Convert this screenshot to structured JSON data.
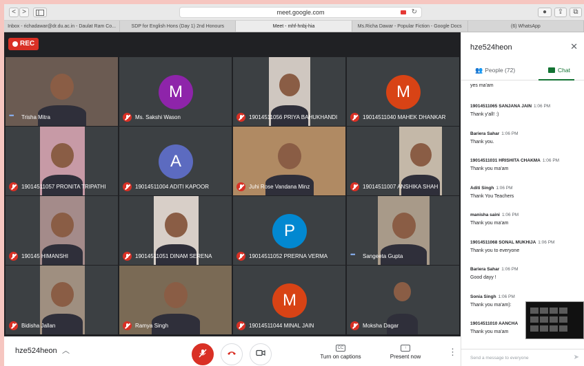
{
  "browser": {
    "nav_back": "<",
    "nav_forward": ">",
    "sidebar_icon": "sidebar-icon",
    "url": "meet.google.com",
    "tabs": [
      "Inbox - richadawar@dr.du.ac.in - Daulat Ram Co...",
      "SDP for English Hons (Day 1) 2nd Honours",
      "Meet - mhf-hnbj-hia",
      "Ms.Richa Dawar - Popular Fiction - Google Docs",
      "(6) WhatsApp"
    ],
    "active_tab": 2
  },
  "meet": {
    "rec_label": "REC",
    "meeting_code": "hze524heon",
    "turn_on_captions": "Turn on captions",
    "present_now": "Present now",
    "cc_icon": "CC",
    "colors": {
      "red": "#d93025",
      "green": "#137333",
      "tile": "#3c4043"
    }
  },
  "participants": [
    {
      "name": "Trisha Mitra",
      "mic": "talking",
      "kind": "video",
      "bg": "#6b5b52"
    },
    {
      "name": "Ms. Sakshi Wason",
      "mic": "muted",
      "kind": "avatar",
      "initial": "M",
      "color": "#8e24aa"
    },
    {
      "name": "19014511056 PRIYA BAHUKHANDI",
      "mic": "muted",
      "kind": "video",
      "bg": "#cfc7c0"
    },
    {
      "name": "19014511040 MAHEK DHANKAR",
      "mic": "muted",
      "kind": "avatar",
      "initial": "M",
      "color": "#d84315"
    },
    {
      "name": "19014511057 PRONITA TRIPATHI",
      "mic": "muted",
      "kind": "video",
      "bg": "#c79aa6"
    },
    {
      "name": "19014511004 ADITI KAPOOR",
      "mic": "muted",
      "kind": "avatar",
      "initial": "A",
      "color": "#5c6bc0"
    },
    {
      "name": "Juhi Rose Vandana Minz",
      "mic": "muted",
      "kind": "video",
      "bg": "#b08a63"
    },
    {
      "name": "19014511007 ANSHIKA SHAH",
      "mic": "muted",
      "kind": "video",
      "bg": "#c4b8a8"
    },
    {
      "name": "190145 HIMANSHI",
      "mic": "muted",
      "kind": "video",
      "bg": "#a48b8a"
    },
    {
      "name": "19014511051 DINAM SERENA",
      "mic": "muted",
      "kind": "video",
      "bg": "#d8cfc8"
    },
    {
      "name": "19014511052 PRERNA VERMA",
      "mic": "muted",
      "kind": "avatar",
      "initial": "P",
      "color": "#0288d1"
    },
    {
      "name": "Sangeeta Gupta",
      "mic": "talking",
      "kind": "video",
      "bg": "#a89a89"
    },
    {
      "name": "Bidisha Jallan",
      "mic": "muted",
      "kind": "video",
      "bg": "#9f8f80"
    },
    {
      "name": "Ramya Singh",
      "mic": "muted",
      "kind": "video",
      "bg": "#7a6a55"
    },
    {
      "name": "19014511044 MINAL JAIN",
      "mic": "muted",
      "kind": "avatar",
      "initial": "M",
      "color": "#d84315"
    },
    {
      "name": "Moksha Dagar",
      "mic": "muted",
      "kind": "video",
      "bg": "#3c4043"
    }
  ],
  "panel": {
    "title": "hze524heon",
    "people_tab": "People (72)",
    "chat_tab": "Chat",
    "compose_placeholder": "Send a message to everyone",
    "messages": [
      {
        "sender": "",
        "time": "",
        "text": "yes ma'am"
      },
      {
        "sender": "19014511065 SANJANA JAIN",
        "time": "1:06 PM",
        "text": "Thank y'all! :)"
      },
      {
        "sender": "Bariera Sahar",
        "time": "1:06 PM",
        "text": "Thank you."
      },
      {
        "sender": "19014511031 HRISHITA CHAKMA",
        "time": "1:06 PM",
        "text": "Thank you ma'am"
      },
      {
        "sender": "Aditi Singh",
        "time": "1:06 PM",
        "text": "Thank You Teachers"
      },
      {
        "sender": "manisha saini",
        "time": "1:06 PM",
        "text": "Thank you ma'am"
      },
      {
        "sender": "19014511068 SONAL MUKHIJA",
        "time": "1:06 PM",
        "text": "Thank you to everyone"
      },
      {
        "sender": "Bariera Sahar",
        "time": "1:06 PM",
        "text": "Good dayy !"
      },
      {
        "sender": "Sonia Singh",
        "time": "1:06 PM",
        "text": "Thank you ma'am):"
      },
      {
        "sender": "19014511010 AANCHA",
        "time": "",
        "text": "Thank you ma'am"
      }
    ]
  }
}
